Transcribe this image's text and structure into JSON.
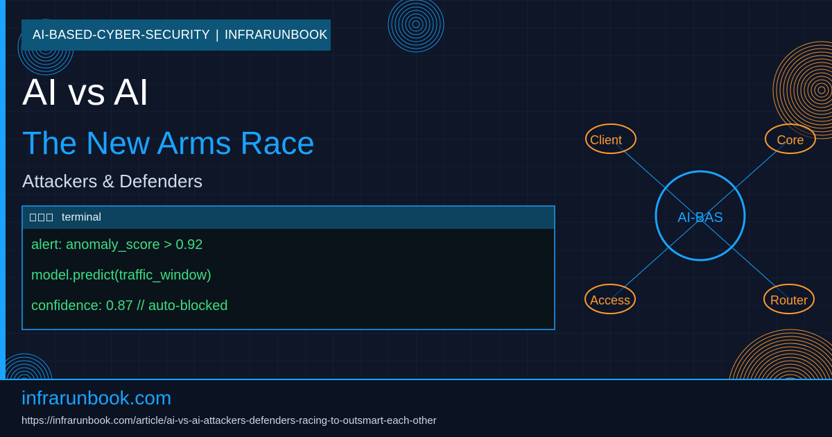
{
  "header": {
    "category": "AI-BASED-CYBER-SECURITY",
    "separator": "|",
    "brand": "INFRARUNBOOK"
  },
  "hero": {
    "title": "AI vs AI",
    "subtitle": "The New Arms Race",
    "description": "Attackers & Defenders"
  },
  "terminal": {
    "title": "terminal",
    "lines": [
      "alert: anomaly_score > 0.92",
      "model.predict(traffic_window)",
      "confidence: 0.87 // auto-blocked"
    ]
  },
  "diagram": {
    "center": "AI-BAS",
    "nodes": [
      "Client",
      "Core",
      "Access",
      "Router"
    ]
  },
  "footer": {
    "site": "infrarunbook.com",
    "url": "https://infrarunbook.com/article/ai-vs-ai-attackers-defenders-racing-to-outsmart-each-other"
  },
  "colors": {
    "background": "#0e1628",
    "accent": "#1aa3ff",
    "terminal_text": "#3ddc84",
    "node_orange": "#ff9a2e"
  }
}
